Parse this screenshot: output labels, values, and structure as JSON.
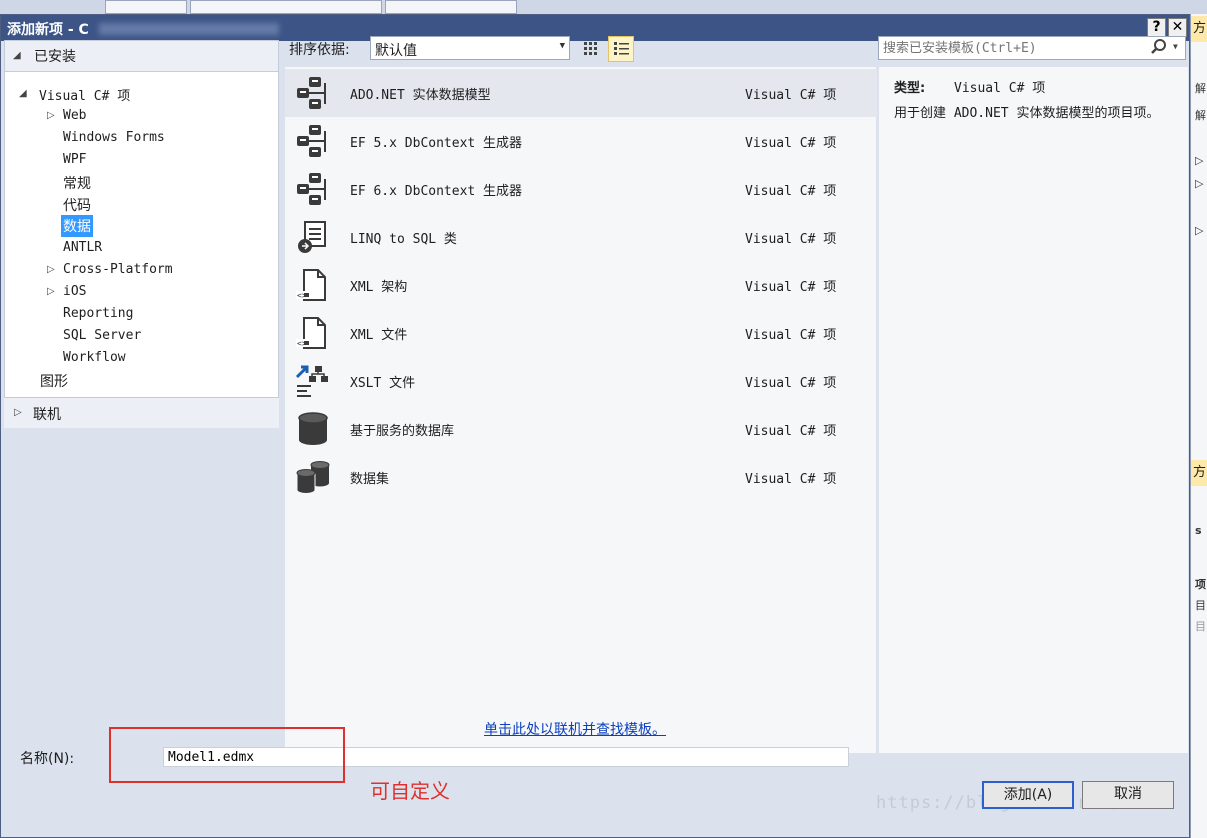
{
  "dialog": {
    "title": "添加新项 - C",
    "help_button": "?",
    "close_button": "✕"
  },
  "tree": {
    "installed": "已安装",
    "visual_csharp": "Visual C# 项",
    "children": [
      "Web",
      "Windows Forms",
      "WPF",
      "常规",
      "代码",
      "数据",
      "ANTLR",
      "Cross-Platform",
      "iOS",
      "Reporting",
      "SQL Server",
      "Workflow"
    ],
    "graphics": "图形",
    "online": "联机"
  },
  "toolbar": {
    "sort_label": "排序依据:",
    "sort_value": "默认值"
  },
  "search": {
    "placeholder": "搜索已安装模板(Ctrl+E)"
  },
  "templates": [
    {
      "name": "ADO.NET 实体数据模型",
      "type": "Visual C# 项",
      "icon": "entity-model-icon"
    },
    {
      "name": "EF 5.x DbContext 生成器",
      "type": "Visual C# 项",
      "icon": "entity-model-icon"
    },
    {
      "name": "EF 6.x DbContext 生成器",
      "type": "Visual C# 项",
      "icon": "entity-model-icon"
    },
    {
      "name": "LINQ to SQL 类",
      "type": "Visual C# 项",
      "icon": "linq-icon"
    },
    {
      "name": "XML 架构",
      "type": "Visual C# 项",
      "icon": "xml-file-icon"
    },
    {
      "name": "XML 文件",
      "type": "Visual C# 项",
      "icon": "xml-file-icon"
    },
    {
      "name": "XSLT 文件",
      "type": "Visual C# 项",
      "icon": "xslt-icon"
    },
    {
      "name": "基于服务的数据库",
      "type": "Visual C# 项",
      "icon": "database-icon"
    },
    {
      "name": "数据集",
      "type": "Visual C# 项",
      "icon": "dataset-icon"
    }
  ],
  "online_link": "单击此处以联机并查找模板。",
  "info": {
    "type_label": "类型:",
    "type_value": "Visual C# 项",
    "description": "用于创建 ADO.NET 实体数据模型的项目项。"
  },
  "name_field": {
    "label": "名称(N):",
    "value": "Model1.edmx"
  },
  "annotation": "可自定义",
  "buttons": {
    "add": "添加(A)",
    "cancel": "取消"
  },
  "watermark": "https://blog.csdn.net/",
  "background_panel": {
    "header_char_1": "方",
    "header_char_2": "方",
    "chars": [
      "解",
      "解",
      "s",
      "项",
      "目",
      "目"
    ]
  },
  "colors": {
    "titlebar": "#3d5486",
    "selection": "#3399ff",
    "annotation": "#e0302d",
    "link": "#0b3fbf"
  }
}
